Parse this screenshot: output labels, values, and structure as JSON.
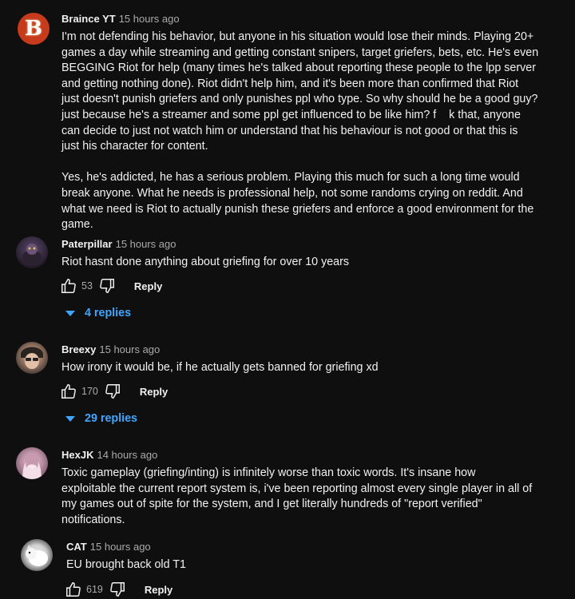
{
  "comments": [
    {
      "author": "Braince YT",
      "time": "15 hours ago",
      "text": "I'm not defending his behavior, but anyone in his situation would lose their minds. Playing 20+\ngames a day while streaming and getting constant snipers, target griefers, bets, etc. He's even\nBEGGING Riot for help (many times he's talked about reporting these people to the lpp server\nand getting nothing done). Riot didn't help him, and it's been more than confirmed that Riot\njust doesn't punish griefers and only punishes ppl who type. So why should he be a good guy?\njust because he's a streamer and some ppl get influenced to be like him? f    k that, anyone\ncan decide to just not watch him or understand that his behaviour is not good or that this is\njust his character for content.\n\nYes, he's addicted, he has a serious problem. Playing this much for such a long time would\nbreak anyone. What he needs is professional help, not some randoms crying on reddit. And\nwhat we need is Riot to actually punish these griefers and enforce a good environment for the\ngame.",
      "avatar_letter": "B"
    },
    {
      "author": "Paterpillar",
      "time": "15 hours ago",
      "text": "Riot hasnt done anything about griefing for over 10 years",
      "likes": "53",
      "reply_label": "Reply",
      "replies_label": "4 replies"
    },
    {
      "author": "Breexy",
      "time": "15 hours ago",
      "text": "How irony it would be, if he actually gets banned for griefing xd",
      "likes": "170",
      "reply_label": "Reply",
      "replies_label": "29 replies"
    },
    {
      "author": "HexJK",
      "time": "14 hours ago",
      "text": "Toxic gameplay (griefing/inting) is infinitely worse than toxic words. It's insane how\nexploitable the current report system is, i've been reporting almost every single player in all of\nmy games out of spite for the system, and I get literally hundreds of \"report verified\"\nnotifications."
    }
  ],
  "reply": {
    "author": "CAT",
    "time": "15 hours ago",
    "text": "EU brought back old T1",
    "likes": "619",
    "reply_label": "Reply"
  },
  "colors": {
    "background": "#0f0f0f",
    "text": "#f1f1f1",
    "secondary": "#aaaaaa",
    "link": "#3ea6ff",
    "avatar_braince": "#c63b1c"
  }
}
